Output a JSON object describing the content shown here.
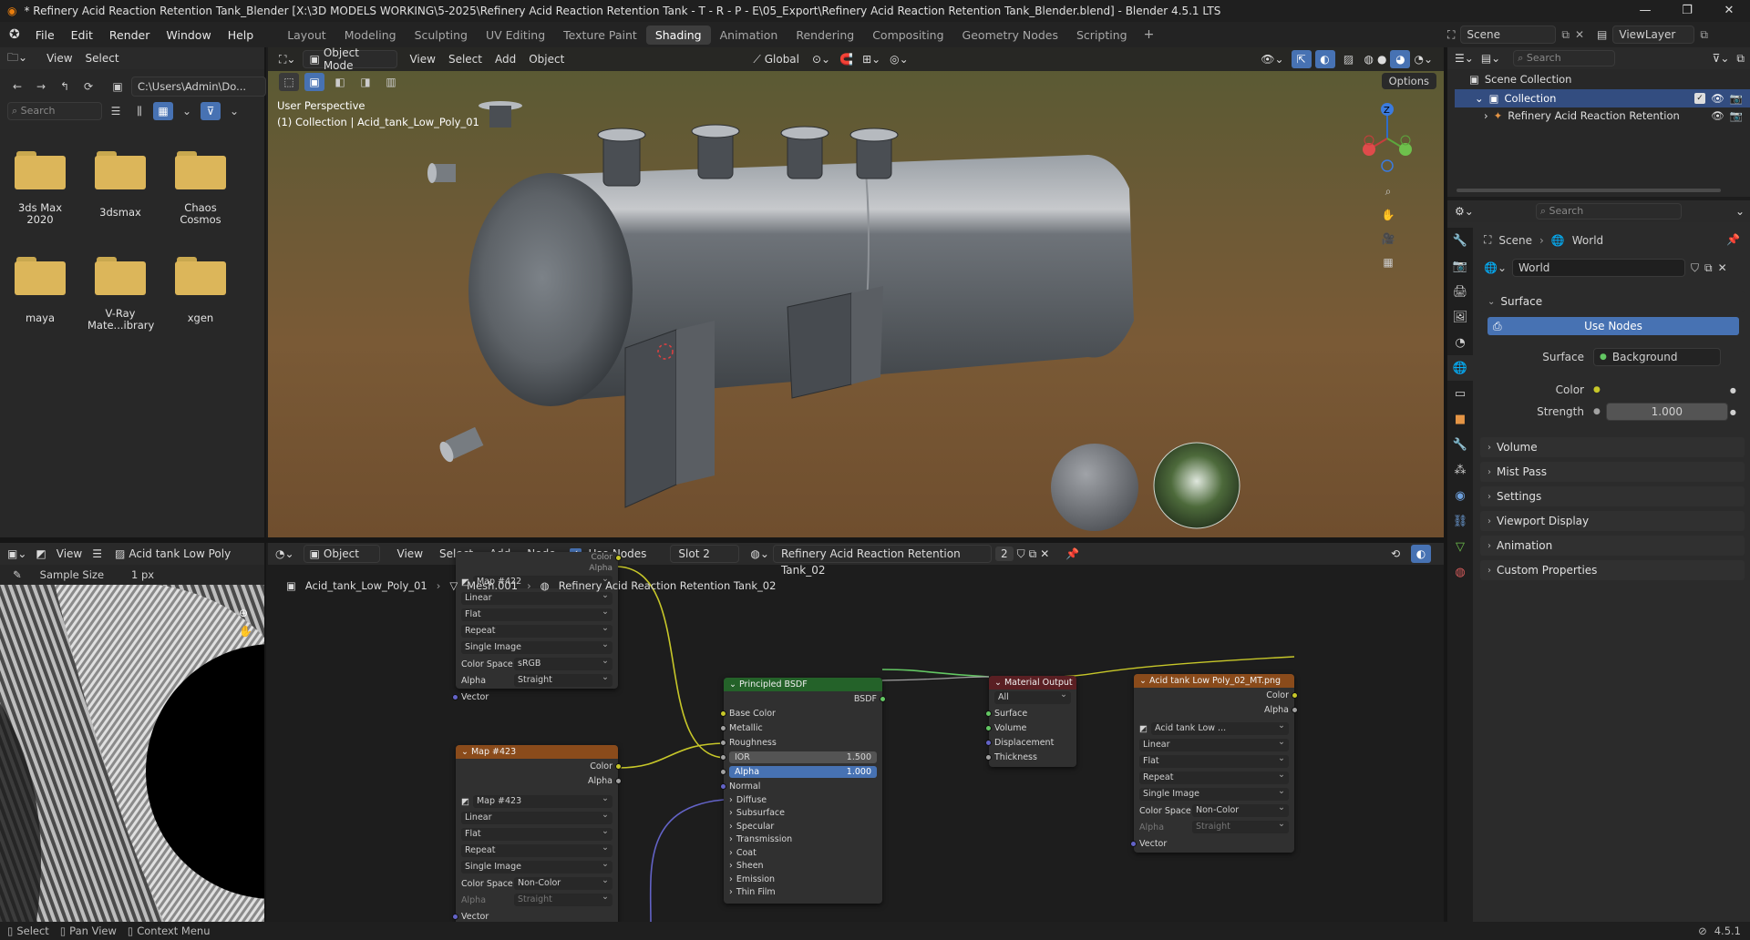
{
  "window": {
    "title": "* Refinery Acid Reaction Retention Tank_Blender [X:\\3D MODELS WORKING\\5-2025\\Refinery Acid Reaction Retention Tank - T - R - P - E\\05_Export\\Refinery Acid Reaction Retention Tank_Blender.blend] - Blender 4.5.1 LTS"
  },
  "menu": [
    "File",
    "Edit",
    "Render",
    "Window",
    "Help"
  ],
  "workspaces": [
    "Layout",
    "Modeling",
    "Sculpting",
    "UV Editing",
    "Texture Paint",
    "Shading",
    "Animation",
    "Rendering",
    "Compositing",
    "Geometry Nodes",
    "Scripting"
  ],
  "active_workspace": "Shading",
  "scene": {
    "label": "Scene",
    "viewlayer": "ViewLayer"
  },
  "filebrowser": {
    "menu": [
      "View",
      "Select"
    ],
    "path": "C:\\Users\\Admin\\Do...",
    "search_placeholder": "Search",
    "folders": [
      {
        "name": "3ds Max\n2020"
      },
      {
        "name": "3dsmax"
      },
      {
        "name": "Chaos\nCosmos"
      },
      {
        "name": "maya"
      },
      {
        "name": "V-Ray\nMate...ibrary"
      },
      {
        "name": "xgen"
      }
    ]
  },
  "viewport": {
    "mode": "Object Mode",
    "menu": [
      "View",
      "Select",
      "Add",
      "Object"
    ],
    "transform": "Global",
    "options": "Options",
    "overlay_line1": "User Perspective",
    "overlay_line2": "(1) Collection | Acid_tank_Low_Poly_01",
    "gizmo": {
      "z": "Z"
    }
  },
  "image_editor": {
    "menu": "View",
    "image_name": "Acid tank Low Poly",
    "sample_size_label": "Sample Size",
    "sample_size_value": "1 px"
  },
  "node_editor": {
    "object_type": "Object",
    "menu": [
      "View",
      "Select",
      "Add",
      "Node"
    ],
    "use_nodes_label": "Use Nodes",
    "slot": "Slot 2",
    "material": "Refinery Acid Reaction Retention Tank_02",
    "users": "2",
    "breadcrumb": [
      "Acid_tank_Low_Poly_01",
      "Mesh.001",
      "Refinery Acid Reaction Retention Tank_02"
    ],
    "nodes": {
      "map422": {
        "top_labels": [
          "Color",
          "Alpha"
        ],
        "image": "Map #422",
        "interp": "Linear",
        "proj": "Flat",
        "ext": "Repeat",
        "source": "Single Image",
        "cs_label": "Color Space",
        "cs_value": "sRGB",
        "alpha_label": "Alpha",
        "alpha_value": "Straight",
        "vector": "Vector"
      },
      "map423": {
        "title": "Map #423",
        "out_color": "Color",
        "out_alpha": "Alpha",
        "image": "Map #423",
        "interp": "Linear",
        "proj": "Flat",
        "ext": "Repeat",
        "source": "Single Image",
        "cs_label": "Color Space",
        "cs_value": "Non-Color",
        "alpha_label": "Alpha",
        "alpha_value": "Straight",
        "vector": "Vector"
      },
      "bsdf": {
        "title": "Principled BSDF",
        "out": "BSDF",
        "inputs": [
          "Base Color",
          "Metallic",
          "Roughness"
        ],
        "ior_label": "IOR",
        "ior_value": "1.500",
        "alpha_label": "Alpha",
        "alpha_value": "1.000",
        "normal": "Normal",
        "panels": [
          "Diffuse",
          "Subsurface",
          "Specular",
          "Transmission",
          "Coat",
          "Sheen",
          "Emission",
          "Thin Film"
        ]
      },
      "matout": {
        "title": "Material Output",
        "target": "All",
        "inputs": [
          "Surface",
          "Volume",
          "Displacement",
          "Thickness"
        ]
      },
      "mt": {
        "title": "Acid tank Low Poly_02_MT.png",
        "out_color": "Color",
        "out_alpha": "Alpha",
        "image": "Acid tank Low ...",
        "interp": "Linear",
        "proj": "Flat",
        "ext": "Repeat",
        "source": "Single Image",
        "cs_label": "Color Space",
        "cs_value": "Non-Color",
        "alpha_label": "Alpha",
        "alpha_value": "Straight",
        "vector": "Vector"
      }
    }
  },
  "outliner": {
    "search_placeholder": "Search",
    "items": [
      "Scene Collection",
      "Collection",
      "Refinery Acid Reaction Retention"
    ]
  },
  "properties": {
    "search_placeholder": "Search",
    "breadcrumb": [
      "Scene",
      "World"
    ],
    "world_name": "World",
    "surface_panel": "Surface",
    "use_nodes_button": "Use Nodes",
    "surface_label": "Surface",
    "surface_value": "Background",
    "color_label": "Color",
    "strength_label": "Strength",
    "strength_value": "1.000",
    "panels": [
      "Volume",
      "Mist Pass",
      "Settings",
      "Viewport Display",
      "Animation",
      "Custom Properties"
    ]
  },
  "statusbar": {
    "items": [
      "Select",
      "Pan View",
      "Context Menu"
    ],
    "version": "4.5.1"
  },
  "colors": {
    "accent": "#4772b3",
    "bsdf_header": "#246229",
    "matout_header": "#5a1f23",
    "texture_header": "#8a4b1b"
  }
}
